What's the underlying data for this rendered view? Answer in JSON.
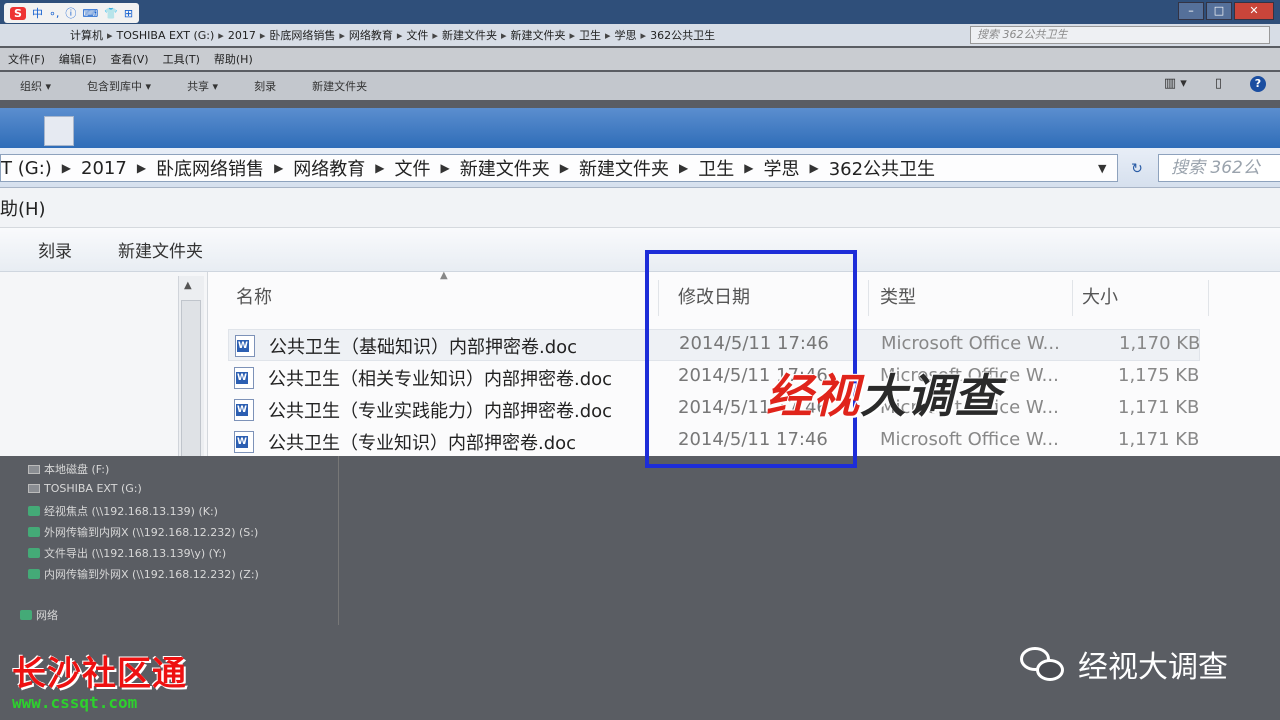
{
  "ime_toolbar": {
    "logo": "S",
    "icons": [
      "中",
      "∘,",
      "ⓘ",
      "⌨",
      "👕",
      "⊞"
    ]
  },
  "bg_window": {
    "address_path": [
      "计算机",
      "TOSHIBA EXT (G:)",
      "2017",
      "卧底网络销售",
      "网络教育",
      "文件",
      "新建文件夹",
      "新建文件夹",
      "卫生",
      "学思",
      "362公共卫生"
    ],
    "search_placeholder": "搜索 362公共卫生",
    "menu": [
      "文件(F)",
      "编辑(E)",
      "查看(V)",
      "工具(T)",
      "帮助(H)"
    ],
    "toolbar": [
      "组织 ▾",
      "包含到库中 ▾",
      "共享 ▾",
      "刻录",
      "新建文件夹"
    ],
    "nav_items": [
      "本地磁盘 (F:)",
      "TOSHIBA EXT (G:)",
      "经视焦点 (\\\\192.168.13.139) (K:)",
      "外网传输到内网X (\\\\192.168.12.232) (S:)",
      "文件导出 (\\\\192.168.13.139\\y) (Y:)",
      "内网传输到外网X (\\\\192.168.12.232) (Z:)"
    ],
    "network_label": "网络"
  },
  "zoom_window": {
    "breadcrumb": [
      "T (G:)",
      "2017",
      "卧底网络销售",
      "网络教育",
      "文件",
      "新建文件夹",
      "新建文件夹",
      "卫生",
      "学思",
      "362公共卫生"
    ],
    "search_placeholder": "搜索 362公",
    "menu_help": "助(H)",
    "toolbar": [
      "刻录",
      "新建文件夹"
    ],
    "columns": {
      "name": "名称",
      "date": "修改日期",
      "type": "类型",
      "size": "大小"
    },
    "files": [
      {
        "name": "公共卫生（基础知识）内部押密卷.doc",
        "date": "2014/5/11 17:46",
        "type": "Microsoft Office W...",
        "size": "1,170 KB"
      },
      {
        "name": "公共卫生（相关专业知识）内部押密卷.doc",
        "date": "2014/5/11 17:46",
        "type": "Microsoft Office W...",
        "size": "1,175 KB"
      },
      {
        "name": "公共卫生（专业实践能力）内部押密卷.doc",
        "date": "2014/5/11 17:46",
        "type": "Microsoft Office W...",
        "size": "1,171 KB"
      },
      {
        "name": "公共卫生（专业知识）内部押密卷.doc",
        "date": "2014/5/11 17:46",
        "type": "Microsoft Office W...",
        "size": "1,171 KB"
      }
    ]
  },
  "overlay": {
    "program_logo_red": "经视",
    "program_logo_dark": "大调查",
    "site_logo": "长沙社区通",
    "site_url": "www.cssqt.com",
    "wechat_account": "经视大调查"
  },
  "colors": {
    "highlight": "#1d2dd8",
    "logo_red": "#e0241b",
    "url_green": "#2dd12d"
  }
}
